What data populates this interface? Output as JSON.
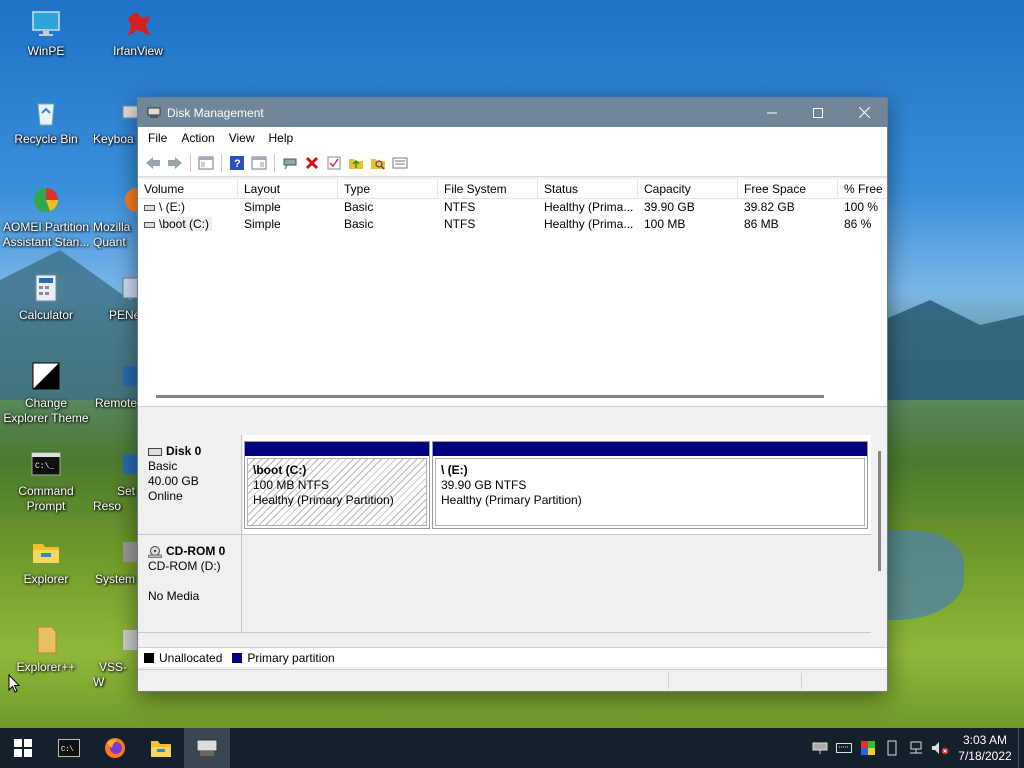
{
  "desktop": {
    "icons": [
      {
        "label": "WinPE",
        "icon": "monitor-icon"
      },
      {
        "label": "IrfanView",
        "icon": "irfanview-icon"
      },
      {
        "label": "Recycle Bin",
        "icon": "recycle-bin-icon"
      },
      {
        "label": "Keyboa",
        "icon": "keyboard-icon"
      },
      {
        "label": "AOMEI Partition Assistant Stan...",
        "icon": "aomei-icon"
      },
      {
        "label": "Mozilla Quant",
        "icon": "firefox-icon"
      },
      {
        "label": "Calculator",
        "icon": "calculator-icon"
      },
      {
        "label": "PENe",
        "icon": "network-icon"
      },
      {
        "label": "Change Explorer Theme",
        "icon": "theme-icon"
      },
      {
        "label": "Remote",
        "icon": "remote-icon"
      },
      {
        "label": "Command Prompt",
        "icon": "cmd-icon"
      },
      {
        "label": "Set Reso",
        "icon": "resolution-icon"
      },
      {
        "label": "Explorer",
        "icon": "explorer-icon"
      },
      {
        "label": "System",
        "icon": "system-icon"
      },
      {
        "label": "Explorer++",
        "icon": "explorerpp-icon"
      },
      {
        "label": "VSS-W",
        "icon": "vss-icon"
      }
    ]
  },
  "window": {
    "title": "Disk Management",
    "menu": [
      "File",
      "Action",
      "View",
      "Help"
    ],
    "toolbar_icons": [
      "back-arrow-icon",
      "forward-arrow-icon",
      "console-tree-icon",
      "help-icon",
      "show-hide-icon",
      "connect-icon",
      "delete-icon",
      "check-icon",
      "folder-up-icon",
      "folder-search-icon",
      "properties-icon"
    ]
  },
  "volumes": {
    "columns": [
      "Volume",
      "Layout",
      "Type",
      "File System",
      "Status",
      "Capacity",
      "Free Space",
      "% Free"
    ],
    "rows": [
      [
        "\\ (E:)",
        "Simple",
        "Basic",
        "NTFS",
        "Healthy (Prima...",
        "39.90 GB",
        "39.82 GB",
        "100 %"
      ],
      [
        "\\boot (C:)",
        "Simple",
        "Basic",
        "NTFS",
        "Healthy (Prima...",
        "100 MB",
        "86 MB",
        "86 %"
      ]
    ]
  },
  "disks": {
    "disk0": {
      "name": "Disk 0",
      "type": "Basic",
      "size": "40.00 GB",
      "state": "Online",
      "partitions": [
        {
          "name": "\\boot  (C:)",
          "size": "100 MB NTFS",
          "status": "Healthy (Primary Partition)"
        },
        {
          "name": "\\  (E:)",
          "size": "39.90 GB NTFS",
          "status": "Healthy (Primary Partition)"
        }
      ]
    },
    "cdrom0": {
      "name": "CD-ROM 0",
      "drive": "CD-ROM (D:)",
      "media": "No Media"
    }
  },
  "legend": {
    "unallocated": "Unallocated",
    "primary": "Primary partition",
    "unallocated_color": "#000000",
    "primary_color": "#000080"
  },
  "taskbar": {
    "time": "3:03 AM",
    "date": "7/18/2022"
  }
}
